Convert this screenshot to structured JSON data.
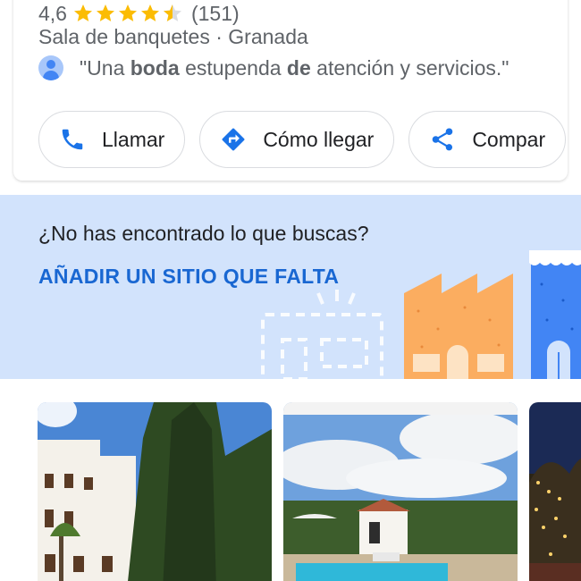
{
  "place": {
    "rating": "4,6",
    "review_count": "(151)",
    "stars_filled": 4.5,
    "category": "Sala de banquetes · Granada",
    "review_snippet": {
      "open_quote": "\"Una ",
      "bold1": "boda",
      "mid": " estupenda ",
      "bold2": "de",
      "rest": " atención y servicios.\""
    }
  },
  "actions": {
    "call_label": "Llamar",
    "directions_label": "Cómo llegar",
    "share_label": "Compar"
  },
  "banner": {
    "question": "¿No has encontrado lo que buscas?",
    "link_label": "AÑADIR UN SITIO QUE FALTA"
  },
  "photos": {
    "items": [
      "hotel-exterior-photo",
      "pool-photo",
      "night-event-photo"
    ]
  },
  "colors": {
    "star": "#fbbc04",
    "link": "#1967d2",
    "icon_blue": "#1a73e8",
    "banner_bg": "#d2e3fc"
  }
}
